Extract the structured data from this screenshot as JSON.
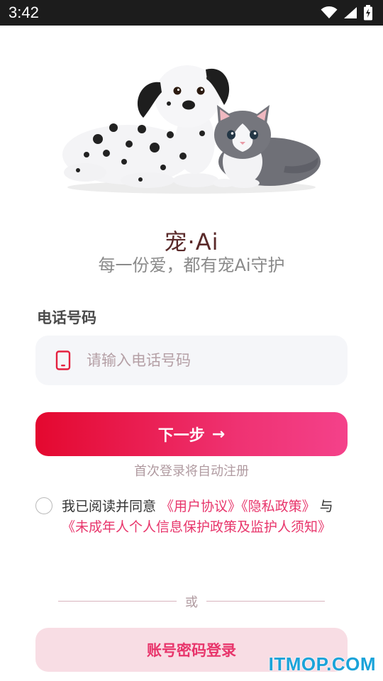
{
  "status_bar": {
    "time": "3:42",
    "icons": [
      "wifi-icon",
      "cell-signal-icon",
      "battery-charging-icon"
    ]
  },
  "hero": {
    "image": "dalmatian-puppy-and-gray-kitten-illustration"
  },
  "app": {
    "title": "宠·Ai",
    "subtitle": "每一份爱，都有宠Ai守护"
  },
  "phone": {
    "label": "电话号码",
    "placeholder": "请输入电话号码",
    "value": "",
    "icon": "mobile-phone-icon"
  },
  "next_button": {
    "label": "下一步",
    "arrow": "→"
  },
  "auto_register_hint": "首次登录将自动注册",
  "agreement": {
    "checked": false,
    "prefix": "我已阅读并同意 ",
    "user_agreement": "《用户协议》",
    "privacy_policy": "《隐私政策》",
    "and": " 与 ",
    "minor_policy": "《未成年人个人信息保护政策及监护人须知》"
  },
  "divider_text": "或",
  "password_login_button": "账号密码登录",
  "watermark": "ITMOP.COM",
  "colors": {
    "accent": "#E8356B",
    "gradient_start": "#E4082F",
    "gradient_end": "#F4418A",
    "secondary_button_bg": "#F8DDE4",
    "input_bg": "#F5F6F9"
  }
}
